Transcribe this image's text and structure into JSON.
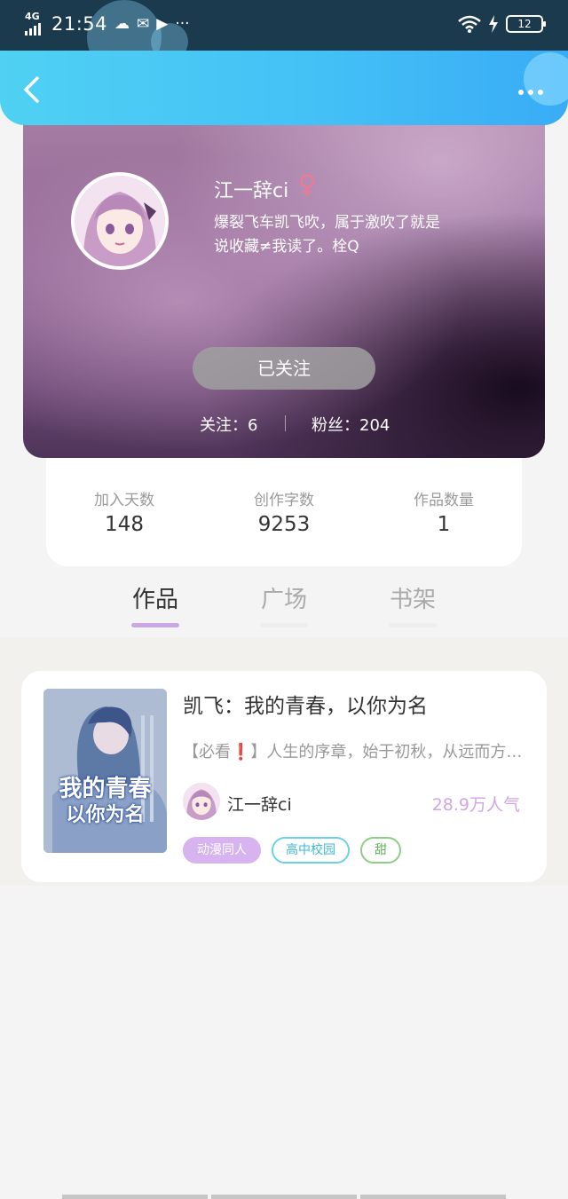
{
  "status": {
    "network": "4G",
    "time": "21:54",
    "battery": "12",
    "more": "···"
  },
  "profile": {
    "name": "江一辞ci",
    "gender_symbol": "♀",
    "bio": "爆裂飞车凯飞吹，属于激吹了就是说收藏≠我读了。栓Q",
    "follow_button": "已关注",
    "following": "关注：6",
    "fans": "粉丝：204"
  },
  "stats": [
    {
      "label": "加入天数",
      "value": "148"
    },
    {
      "label": "创作字数",
      "value": "9253"
    },
    {
      "label": "作品数量",
      "value": "1"
    }
  ],
  "tabs": [
    {
      "label": "作品",
      "active": true
    },
    {
      "label": "广场",
      "active": false
    },
    {
      "label": "书架",
      "active": false
    }
  ],
  "work": {
    "title": "凯飞：我的青春，以你为名",
    "description": "【必看❗】人生的序章，始于初秋，从远而方来…",
    "cover_line1": "我的青春",
    "cover_line2": "以你为名",
    "author": "江一辞ci",
    "popularity": "28.9万人气",
    "tags": [
      "动漫同人",
      "高中校园",
      "甜"
    ]
  },
  "colors": {
    "header_start": "#4fd1f3",
    "header_end": "#39acf6",
    "tab_indicator": "#c9a8e6",
    "popularity": "#d2a6e4",
    "gender": "#ef7a92"
  }
}
